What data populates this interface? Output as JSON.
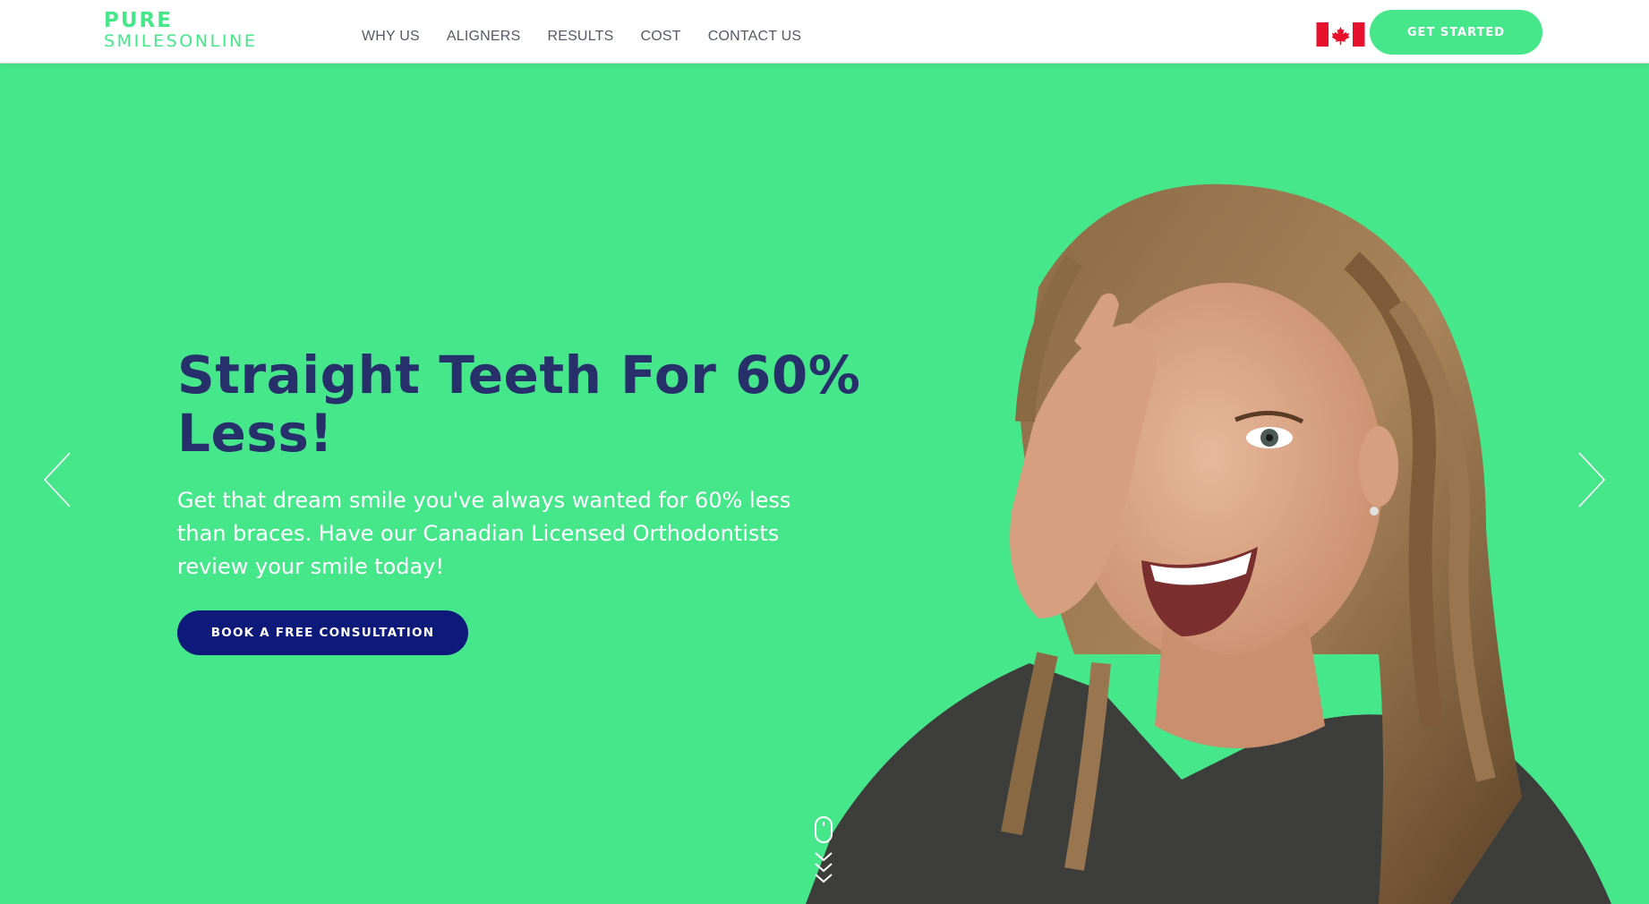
{
  "header": {
    "logo": {
      "line1": "PURE",
      "line2": "SMILESONLINE"
    },
    "nav": [
      {
        "label": "WHY US"
      },
      {
        "label": "ALIGNERS"
      },
      {
        "label": "RESULTS"
      },
      {
        "label": "COST"
      },
      {
        "label": "CONTACT US"
      }
    ],
    "country_flag": "canada-flag-icon",
    "cta_label": "GET STARTED"
  },
  "hero": {
    "title": "Straight Teeth For 60% Less!",
    "subtitle": "Get that dream smile you've always wanted for 60% less than braces. Have our Canadian Licensed Orthodontists review your smile today!",
    "cta_label": "BOOK A FREE CONSULTATION",
    "prev_icon": "chevron-left-icon",
    "next_icon": "chevron-right-icon",
    "scroll_icon": "scroll-down-icon"
  },
  "colors": {
    "brand_green": "#46e68b",
    "title_navy": "#28306c",
    "button_navy": "#0e1a7a",
    "nav_text": "#555a66"
  }
}
